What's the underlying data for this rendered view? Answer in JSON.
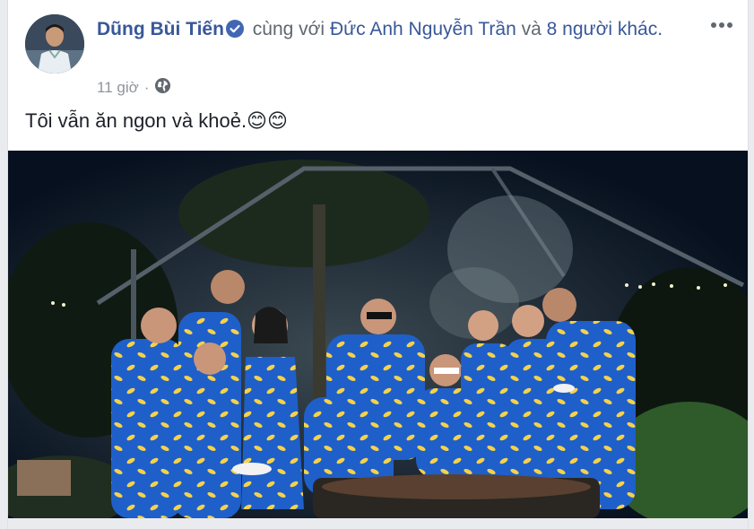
{
  "post": {
    "author": "Dũng Bùi Tiến",
    "with_text": "cùng với",
    "tagged": "Đức Anh Nguyễn Trần",
    "and_text": "và",
    "others": "8 người khác.",
    "time": "11 giờ",
    "separator": "·",
    "privacy_icon": "globe-icon",
    "text": "Tôi vẫn ăn ngon và khoẻ.😊😊"
  },
  "colors": {
    "link": "#385898",
    "verified": "#4267b2",
    "meta": "#90949c",
    "shirt": "#1f5fc9",
    "banana": "#f5d24a"
  }
}
